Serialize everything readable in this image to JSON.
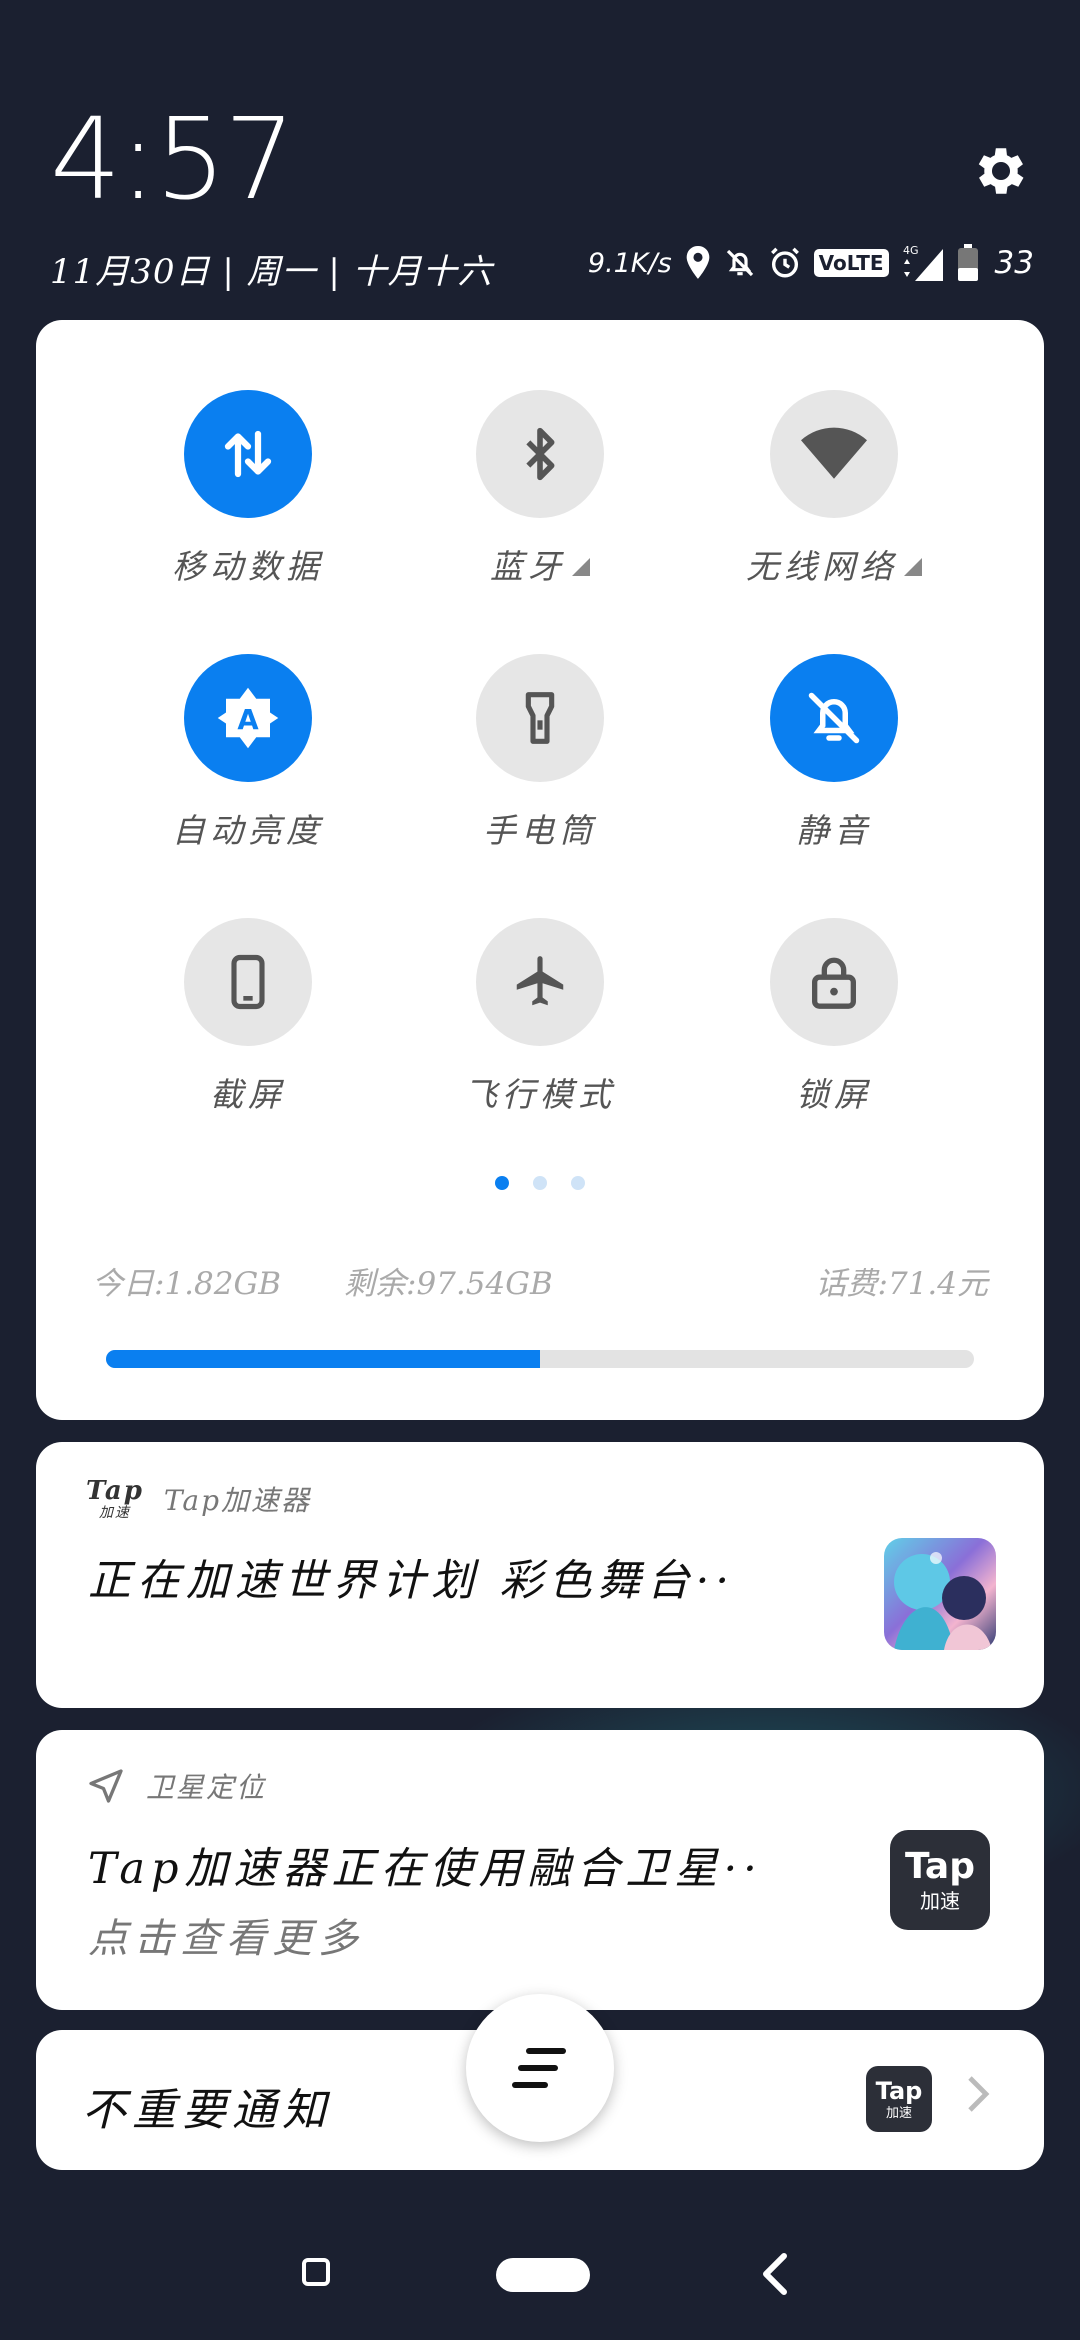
{
  "status": {
    "time": "4:57",
    "date": "11月30日 | 周一 | 十月十六",
    "net_speed": "9.1K/s",
    "volte": "VoLTE",
    "network": "4G",
    "battery": "33"
  },
  "quick_settings": {
    "tiles": [
      {
        "label": "移动数据",
        "icon": "mobile-data-icon",
        "active": true
      },
      {
        "label": "蓝牙",
        "icon": "bluetooth-icon",
        "active": false
      },
      {
        "label": "无线网络",
        "icon": "wifi-icon",
        "active": false
      },
      {
        "label": "自动亮度",
        "icon": "auto-brightness-icon",
        "active": true
      },
      {
        "label": "手电筒",
        "icon": "flashlight-icon",
        "active": false
      },
      {
        "label": "静音",
        "icon": "silent-icon",
        "active": true
      },
      {
        "label": "截屏",
        "icon": "screenshot-icon",
        "active": false
      },
      {
        "label": "飞行模式",
        "icon": "airplane-icon",
        "active": false
      },
      {
        "label": "锁屏",
        "icon": "lock-icon",
        "active": false
      }
    ],
    "page_count": 3,
    "current_page": 1,
    "usage": {
      "today": "今日:1.82GB",
      "remaining": "剩余:97.54GB",
      "balance": "话费:71.4元",
      "progress": 0.5
    }
  },
  "notifications": [
    {
      "app": "Tap加速器",
      "title": "正在加速世界计划 彩色舞台··"
    },
    {
      "app": "卫星定位",
      "title": "Tap加速器正在使用融合卫星··",
      "subtitle": "点击查看更多"
    }
  ],
  "tap_logo": {
    "line1": "Tap",
    "line2": "加速"
  },
  "unimportant": {
    "label": "不重要通知"
  },
  "colors": {
    "accent": "#0a7ff0",
    "background": "#1b2030",
    "tile_inactive": "#e6e6e6"
  }
}
